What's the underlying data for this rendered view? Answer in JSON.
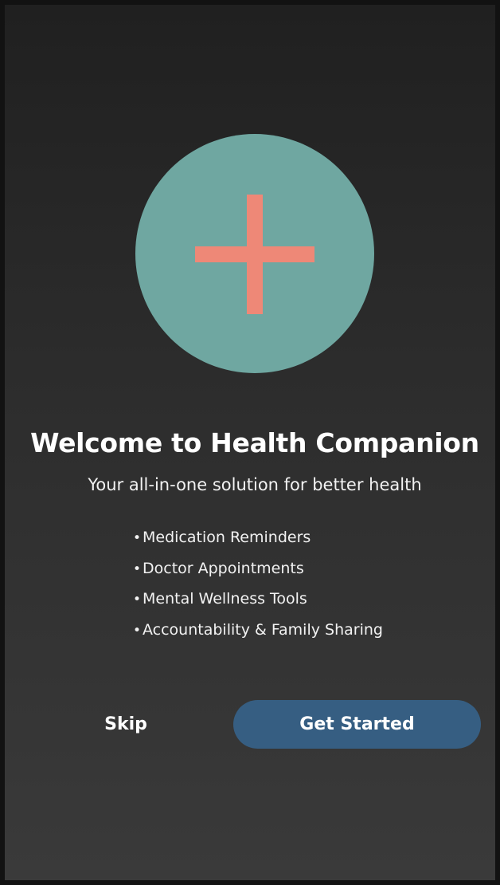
{
  "welcome": {
    "title": "Welcome to Health Companion",
    "subtitle": "Your all-in-one solution for better health"
  },
  "features": [
    {
      "bullet": "•",
      "label": "Medication Reminders"
    },
    {
      "bullet": "•",
      "label": "Doctor Appointments"
    },
    {
      "bullet": "•",
      "label": "Mental Wellness Tools"
    },
    {
      "bullet": "•",
      "label": "Accountability & Family Sharing"
    }
  ],
  "actions": {
    "skip_label": "Skip",
    "get_started_label": "Get Started"
  },
  "icons": {
    "logo": "medical-plus-icon"
  },
  "colors": {
    "background_top": "#202020",
    "background_bottom": "#3a3a3a",
    "logo_circle": "#6fa7a1",
    "logo_plus": "#ee8877",
    "primary_button": "#365e82",
    "text": "#ffffff"
  }
}
